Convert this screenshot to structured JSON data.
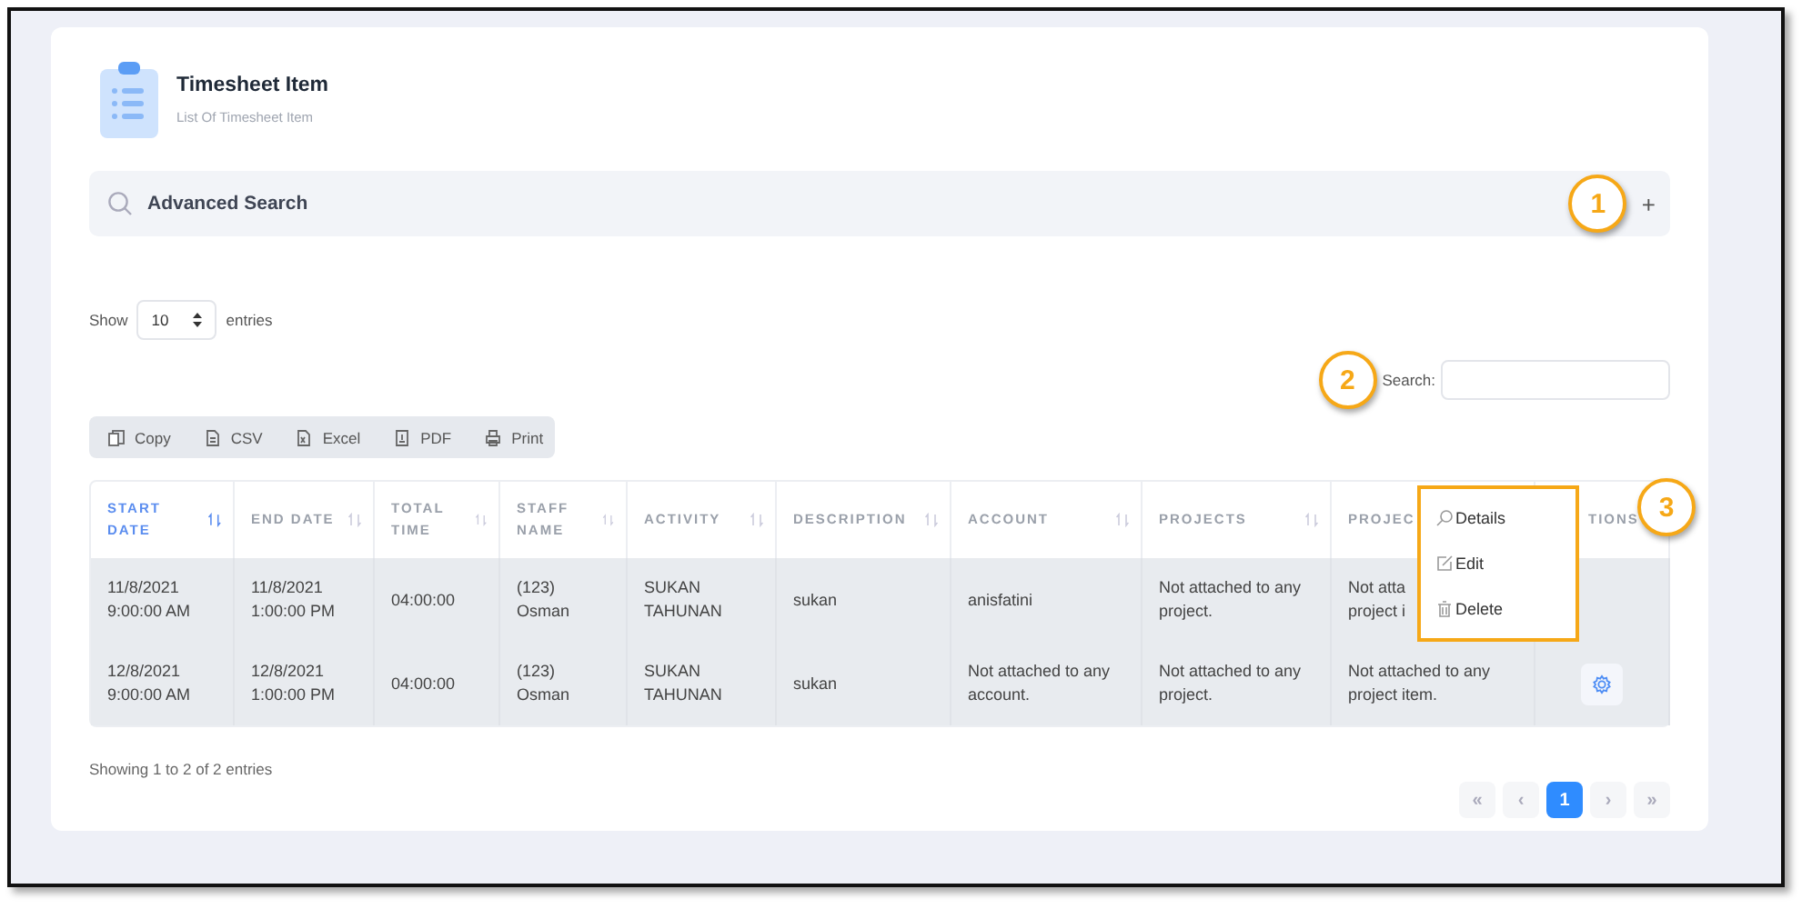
{
  "header": {
    "title": "Timesheet Item",
    "subtitle": "List Of Timesheet Item"
  },
  "advanced_search": {
    "label": "Advanced Search",
    "toggle": "+",
    "callout": "1"
  },
  "length": {
    "prefix": "Show",
    "value": "10",
    "suffix": "entries"
  },
  "search": {
    "label": "Search:",
    "callout": "2"
  },
  "export_buttons": [
    {
      "label": "Copy",
      "kind": "copy"
    },
    {
      "label": "CSV",
      "kind": "csv"
    },
    {
      "label": "Excel",
      "kind": "excel"
    },
    {
      "label": "PDF",
      "kind": "pdf"
    },
    {
      "label": "Print",
      "kind": "print"
    }
  ],
  "table": {
    "columns": [
      {
        "label": "START DATE",
        "sorted": true
      },
      {
        "label": "END DATE",
        "sorted": false
      },
      {
        "label": "TOTAL TIME",
        "sorted": false
      },
      {
        "label": "STAFF NAME",
        "sorted": false
      },
      {
        "label": "ACTIVITY",
        "sorted": false
      },
      {
        "label": "DESCRIPTION",
        "sorted": false
      },
      {
        "label": "ACCOUNT",
        "sorted": false
      },
      {
        "label": "PROJECTS",
        "sorted": false
      },
      {
        "label": "PROJEC",
        "sorted": false
      },
      {
        "label": "TIONS",
        "sorted": false
      }
    ],
    "rows": [
      {
        "cells": [
          "11/8/2021 9:00:00 AM",
          "11/8/2021 1:00:00 PM",
          "04:00:00",
          "(123) Osman",
          "SUKAN TAHUNAN",
          "sukan",
          "anisfatini",
          "Not attached to any project.",
          "Not atta\nproject i"
        ],
        "gear": false
      },
      {
        "cells": [
          "12/8/2021 9:00:00 AM",
          "12/8/2021 1:00:00 PM",
          "04:00:00",
          "(123) Osman",
          "SUKAN TAHUNAN",
          "sukan",
          "Not attached to any account.",
          "Not attached to any project.",
          "Not attached to any project item."
        ],
        "gear": true
      }
    ]
  },
  "menu": {
    "callout": "3",
    "items": [
      {
        "label": "Details",
        "kind": "details"
      },
      {
        "label": "Edit",
        "kind": "edit"
      },
      {
        "label": "Delete",
        "kind": "delete"
      }
    ]
  },
  "info": "Showing 1 to 2 of 2 entries",
  "pagination": [
    {
      "label": "«",
      "selected": false
    },
    {
      "label": "‹",
      "selected": false
    },
    {
      "label": "1",
      "selected": true
    },
    {
      "label": "›",
      "selected": false
    },
    {
      "label": "»",
      "selected": false
    }
  ]
}
